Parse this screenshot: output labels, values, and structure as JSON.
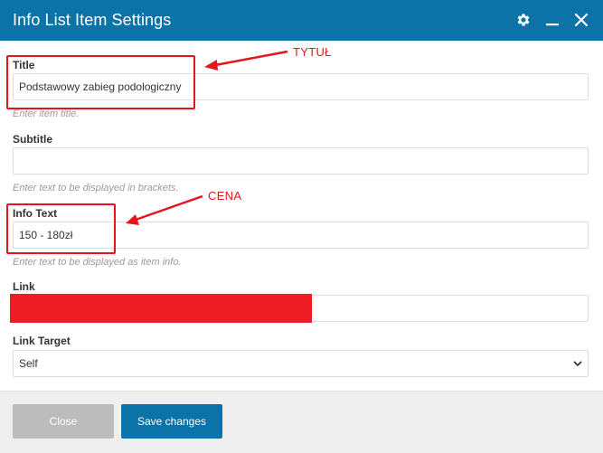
{
  "dialog": {
    "title": "Info List Item Settings"
  },
  "fields": {
    "title": {
      "label": "Title",
      "value": "Podstawowy zabieg podologiczny",
      "help": "Enter item title."
    },
    "subtitle": {
      "label": "Subtitle",
      "value": "",
      "help": "Enter text to be displayed in brackets."
    },
    "info_text": {
      "label": "Info Text",
      "value": "150 - 180zł",
      "help": "Enter text to be displayed as item info."
    },
    "link": {
      "label": "Link",
      "value": ""
    },
    "link_target": {
      "label": "Link Target",
      "selected": "Self"
    }
  },
  "annotations": {
    "title_note": "TYTUŁ",
    "price_note": "CENA",
    "color": "#e8141c"
  },
  "footer": {
    "close_label": "Close",
    "save_label": "Save changes"
  },
  "colors": {
    "header": "#0b73a8",
    "save_button": "#0b73a8",
    "close_button": "#bcbcbc",
    "redaction": "#ee1c25"
  }
}
